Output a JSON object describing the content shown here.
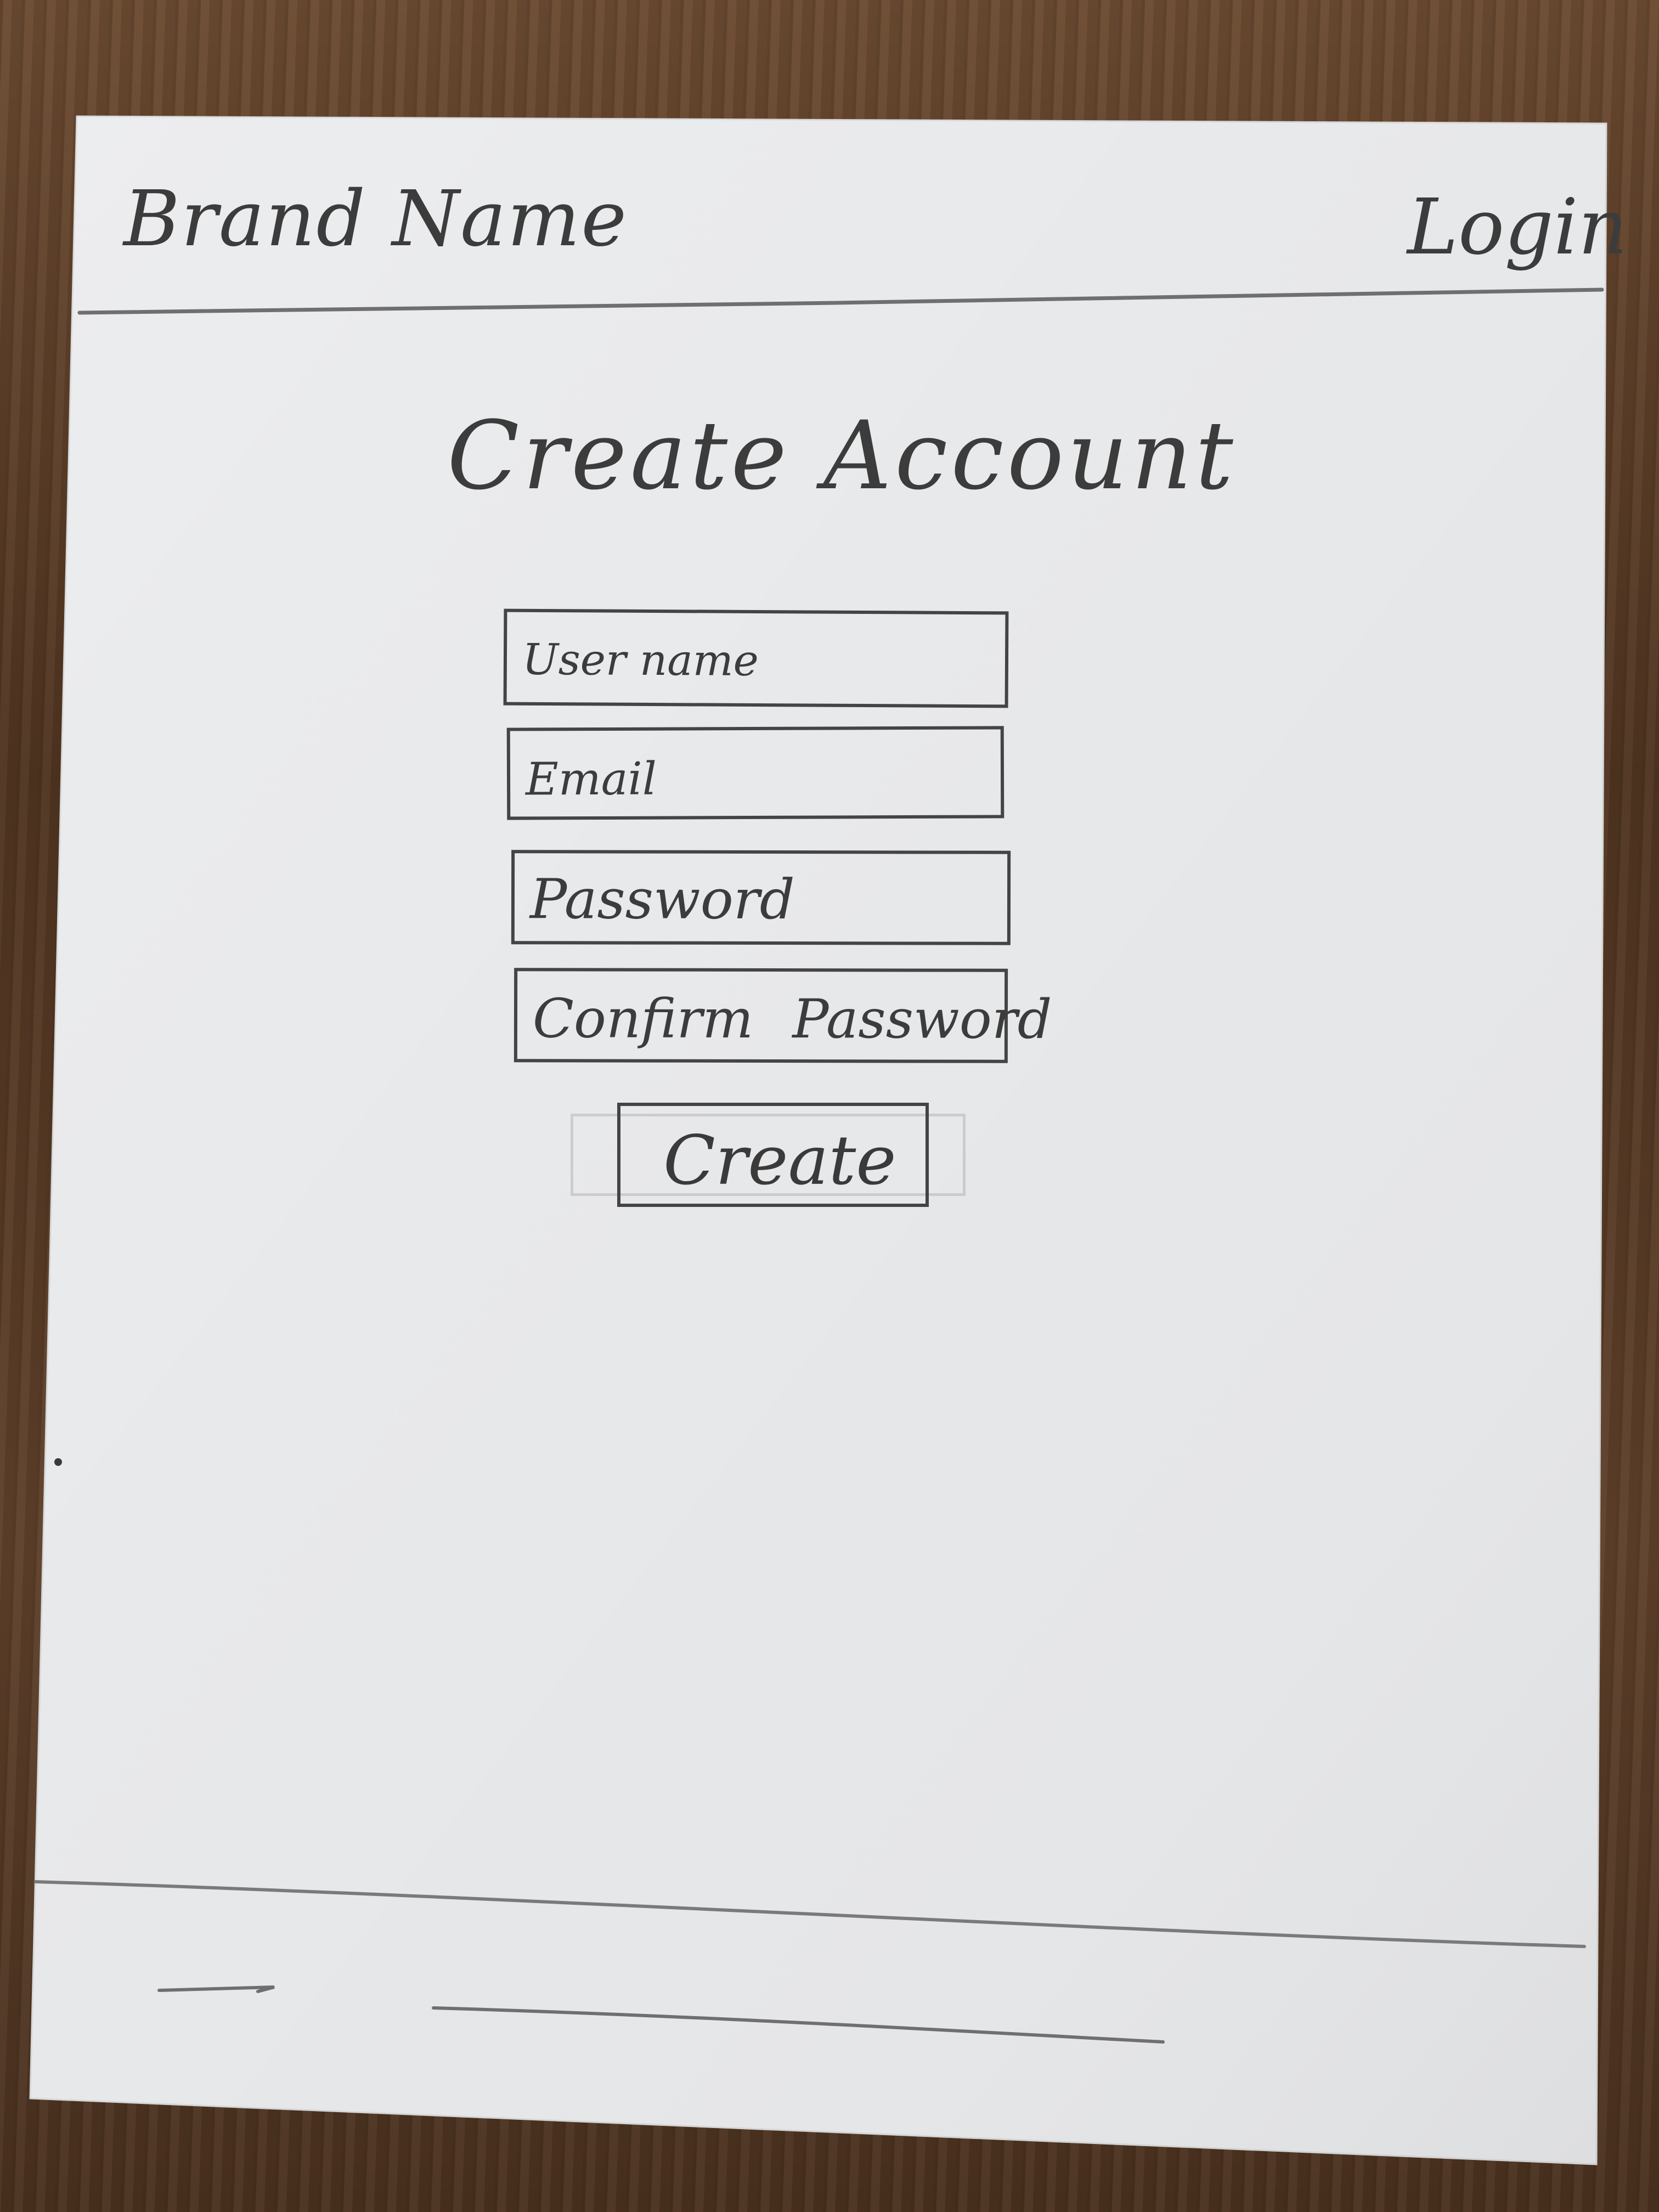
{
  "header": {
    "brand_name": "Brand Name",
    "login_link": "Login"
  },
  "main": {
    "title": "Create Account",
    "fields": {
      "username_placeholder": "User name",
      "email_placeholder": "Email",
      "password_placeholder": "Password",
      "confirm_password_placeholder": "Confirm Password"
    },
    "create_button_label": "Create"
  }
}
